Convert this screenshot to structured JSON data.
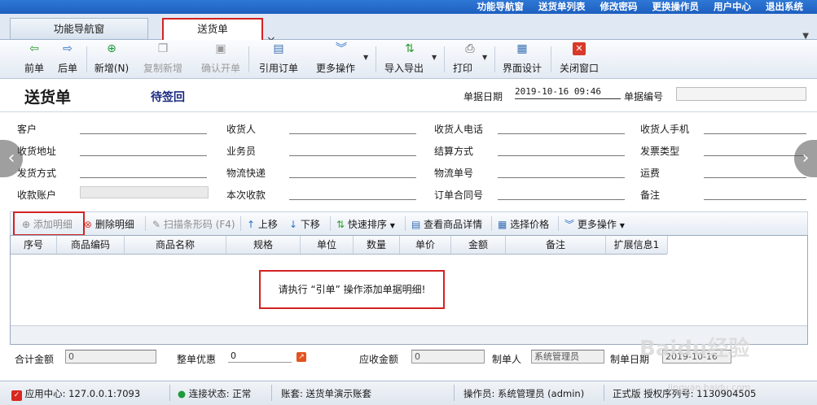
{
  "topnav": [
    "功能导航窗",
    "送货单列表",
    "修改密码",
    "更换操作员",
    "用户中心",
    "退出系统"
  ],
  "tabs": [
    {
      "label": "功能导航窗",
      "active": false
    },
    {
      "label": "送货单",
      "active": true
    }
  ],
  "tab_close": "×",
  "toolbar": [
    {
      "label": "前单",
      "icon": "arrow-left-icon",
      "enabled": true
    },
    {
      "label": "后单",
      "icon": "arrow-right-icon",
      "enabled": true
    },
    {
      "label": "新增(N)",
      "icon": "plus-circle-icon",
      "enabled": true
    },
    {
      "label": "复制新增",
      "icon": "copy-icon",
      "enabled": false
    },
    {
      "label": "确认开单",
      "icon": "save-icon",
      "enabled": false
    },
    {
      "label": "引用订单",
      "icon": "document-icon",
      "enabled": true
    },
    {
      "label": "更多操作",
      "icon": "chevrons-down-icon",
      "enabled": true
    },
    {
      "label": "导入导出",
      "icon": "import-export-icon",
      "enabled": true
    },
    {
      "label": "打印",
      "icon": "printer-icon",
      "enabled": true
    },
    {
      "label": "界面设计",
      "icon": "layout-icon",
      "enabled": true
    },
    {
      "label": "关闭窗口",
      "icon": "close-window-icon",
      "enabled": true
    }
  ],
  "document": {
    "title": "送货单",
    "status": "待签回",
    "date_label": "单据日期",
    "date_value": "2019-10-16 09:46",
    "number_label": "单据编号",
    "number_value": ""
  },
  "form": {
    "row1": [
      "客户",
      "收货人",
      "收货人电话",
      "收货人手机"
    ],
    "row2": [
      "收货地址",
      "业务员",
      "结算方式",
      "发票类型"
    ],
    "row3": [
      "发货方式",
      "物流快递",
      "物流单号",
      "运费"
    ],
    "row4": [
      "收款账户",
      "本次收款",
      "订单合同号",
      "备注"
    ]
  },
  "detail_toolbar": [
    {
      "label": "添加明细",
      "icon": "plus-circle-icon",
      "enabled": false
    },
    {
      "label": "删除明细",
      "icon": "delete-icon",
      "enabled": true
    },
    {
      "label": "扫描条形码 (F4)",
      "icon": "barcode-icon",
      "enabled": false
    },
    {
      "label": "上移",
      "icon": "arrow-up-icon",
      "enabled": true
    },
    {
      "label": "下移",
      "icon": "arrow-down-icon",
      "enabled": true
    },
    {
      "label": "快速排序",
      "icon": "sort-icon",
      "enabled": true
    },
    {
      "label": "查看商品详情",
      "icon": "details-icon",
      "enabled": true
    },
    {
      "label": "选择价格",
      "icon": "price-icon",
      "enabled": true
    },
    {
      "label": "更多操作",
      "icon": "chevrons-down-icon",
      "enabled": true
    }
  ],
  "grid": {
    "columns": [
      "序号",
      "商品编码",
      "商品名称",
      "规格",
      "单位",
      "数量",
      "单价",
      "金额",
      "备注",
      "扩展信息1"
    ],
    "empty_message": "请执行 “引单” 操作添加单据明细!"
  },
  "totals": {
    "total_label": "合计金额",
    "total_value": "0",
    "discount_label": "整单优惠",
    "discount_value": "0",
    "receivable_label": "应收金额",
    "receivable_value": "0",
    "maker_label": "制单人",
    "maker_value": "系统管理员",
    "make_date_label": "制单日期",
    "make_date_value": "2019-10-16"
  },
  "statusbar": {
    "app_center": "应用中心: 127.0.0.1:7093",
    "connection": "连接状态: 正常",
    "account": "账套: 送货单演示账套",
    "operator": "操作员: 系统管理员 (admin)",
    "license": "正式版 授权序列号: 1130904505"
  },
  "watermark": "Baidu经验",
  "watermark_url": "jingyan.baidu.com",
  "colors": {
    "highlight": "#d32222",
    "topbar": "#2f78d6",
    "status_title": "#1b2a80"
  }
}
